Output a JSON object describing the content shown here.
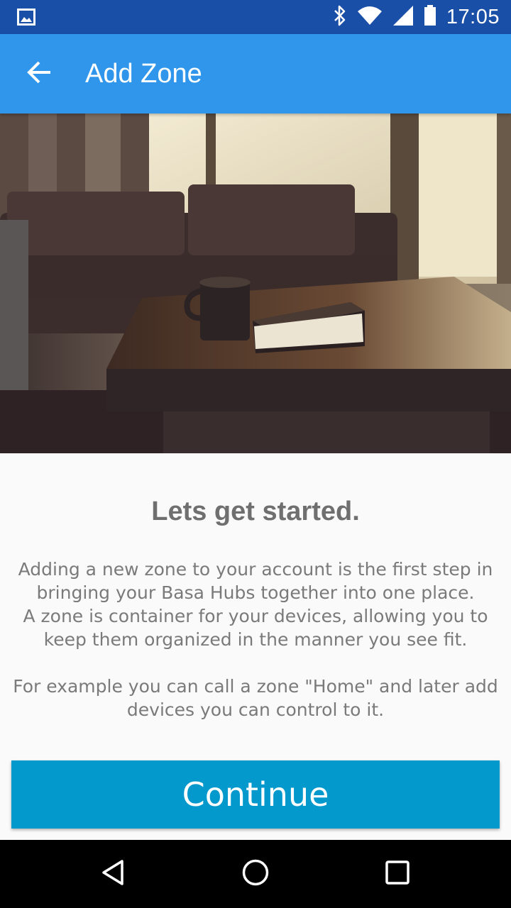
{
  "status_bar": {
    "time": "17:05",
    "icons": [
      "image-notification-icon",
      "bluetooth-icon",
      "wifi-icon",
      "cell-signal-icon",
      "battery-icon"
    ],
    "color": "#1a4fa8"
  },
  "app_bar": {
    "title": "Add Zone",
    "back_icon": "arrow-back-icon",
    "color": "#2f96ec"
  },
  "hero_image": {
    "subject": "living room with sofa, coffee table, mug and book"
  },
  "content": {
    "headline": "Lets get started.",
    "paragraphs": [
      "Adding a new zone to your account is the first step in bringing your Basa Hubs together into one place.",
      "A zone is container for your devices, allowing you to keep them organized in the manner you see fit.",
      "For example you can call a zone \"Home\" and later add devices you can control to it."
    ]
  },
  "continue_button": {
    "label": "Continue",
    "color": "#0399cd"
  },
  "nav_bar": {
    "buttons": [
      "back-triangle-icon",
      "home-circle-icon",
      "recents-square-icon"
    ]
  }
}
